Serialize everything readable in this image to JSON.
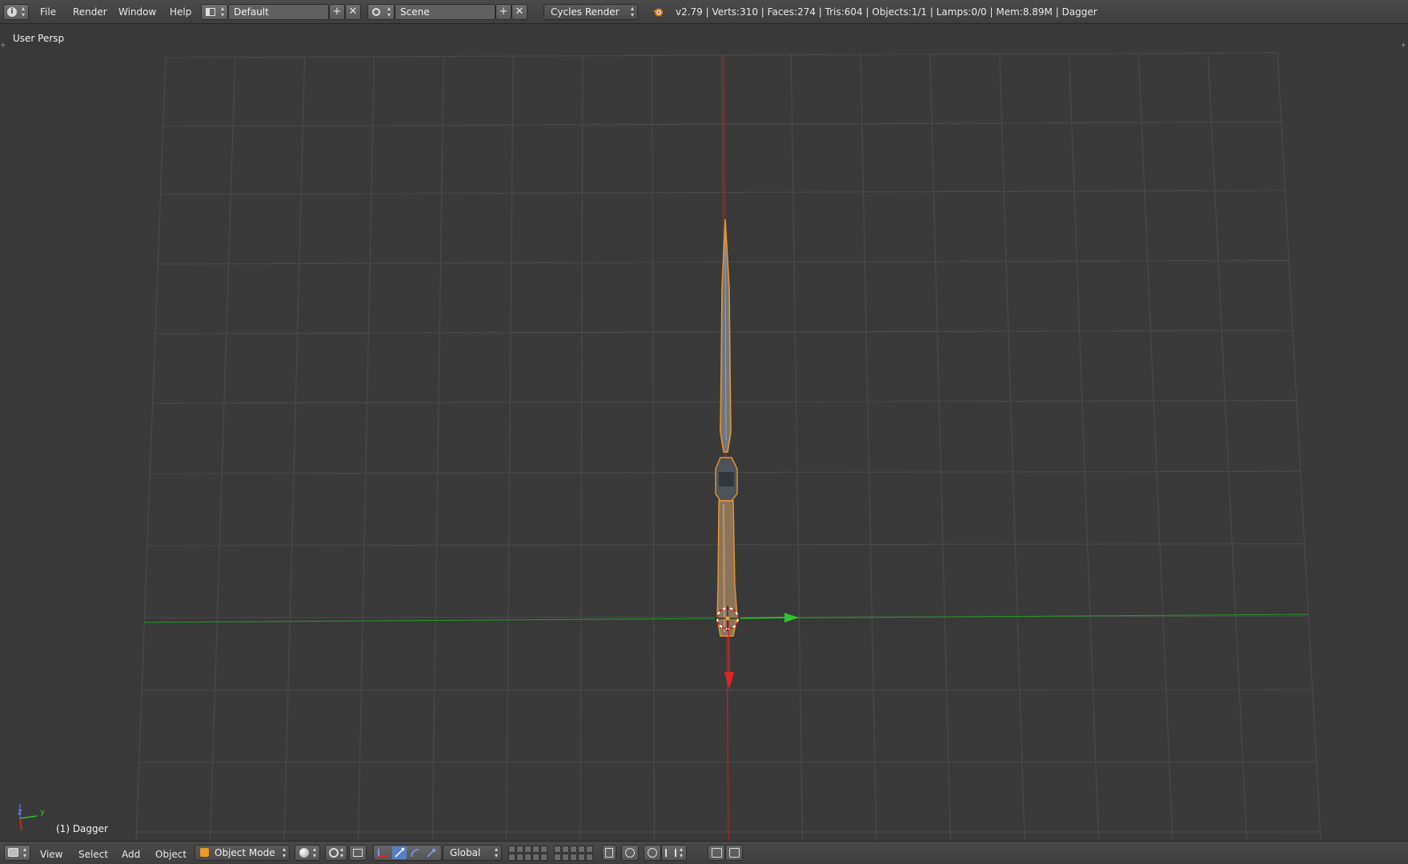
{
  "header": {
    "menus": [
      "File",
      "Render",
      "Window",
      "Help"
    ],
    "layout_name": "Default",
    "scene_name": "Scene",
    "render_engine": "Cycles Render",
    "stats": "v2.79 | Verts:310 | Faces:274 | Tris:604 | Objects:1/1 | Lamps:0/0 | Mem:8.89M | Dagger"
  },
  "viewport": {
    "view_label": "User Persp",
    "object_label": "(1) Dagger",
    "axis_labels": {
      "y": "y",
      "z": "z"
    }
  },
  "footer": {
    "menus": [
      "View",
      "Select",
      "Add",
      "Object"
    ],
    "mode": "Object Mode",
    "orientation": "Global"
  },
  "colors": {
    "background": "#393939",
    "grid": "#4a4a4a",
    "x_axis": "#d42020",
    "y_axis": "#2bb02b",
    "selection": "#f0a030"
  },
  "icons": [
    "info-icon",
    "layout-icon",
    "scene-icon",
    "blender-logo-icon",
    "3d-view-icon",
    "object-mode-icon",
    "shading-icon",
    "pivot-icon",
    "manipulator-icon",
    "layers-icon",
    "render-icon"
  ]
}
